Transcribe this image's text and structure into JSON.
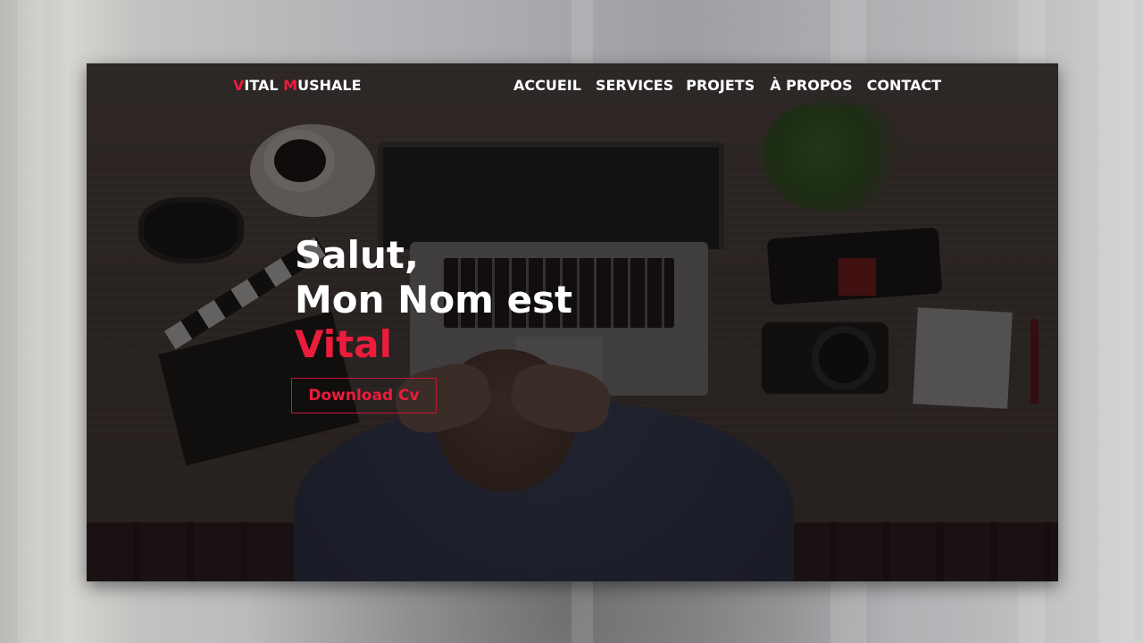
{
  "brand": {
    "first_initial": "V",
    "first_rest": "ITAL ",
    "last_initial": "M",
    "last_rest": "USHALE"
  },
  "nav": {
    "items": [
      {
        "label": "ACCUEIL"
      },
      {
        "label": "SERVICES"
      },
      {
        "label": "PROJETS"
      },
      {
        "label": "À PROPOS"
      },
      {
        "label": "CONTACT"
      }
    ]
  },
  "hero": {
    "greeting": "Salut,",
    "intro": "Mon Nom est",
    "name": "Vital",
    "cta_label": "Download Cv"
  },
  "colors": {
    "accent": "#ec1c3d",
    "text": "#ffffff"
  }
}
